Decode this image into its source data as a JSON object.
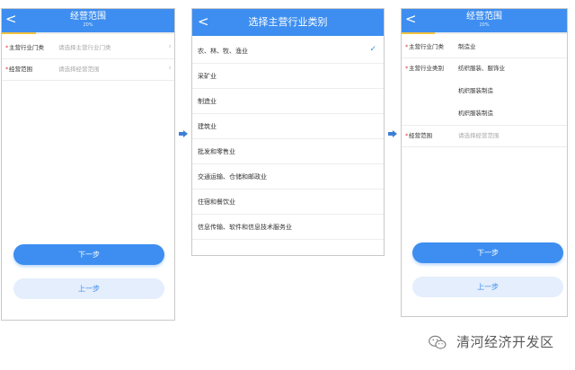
{
  "screen1": {
    "title": "经营范围",
    "progress_text": "20%",
    "progress_value": 0.2,
    "back_glyph": "<",
    "rows": [
      {
        "label": "主营行业门类",
        "placeholder": "请选择主营行业门类"
      },
      {
        "label": "经营范围",
        "placeholder": "请选择经营范围"
      }
    ],
    "next_label": "下一步",
    "prev_label": "上一步"
  },
  "screen2": {
    "title": "选择主营行业类别",
    "back_glyph": "<",
    "items": [
      {
        "label": "农、林、牧、渔业",
        "selected": true
      },
      {
        "label": "采矿业"
      },
      {
        "label": "制造业"
      },
      {
        "label": "建筑业"
      },
      {
        "label": "批发和零售业"
      },
      {
        "label": "交通运输、仓储和邮政业"
      },
      {
        "label": "住宿和餐饮业"
      },
      {
        "label": "信息传输、软件和信息技术服务业"
      }
    ]
  },
  "screen3": {
    "title": "经营范围",
    "progress_text": "20%",
    "progress_value": 0.2,
    "back_glyph": "<",
    "industry_label": "主营行业门类",
    "industry_value": "制造业",
    "category_label": "主营行业类别",
    "category_values": [
      "纺织服装、服饰业",
      "机织服装制造",
      "机织服装制造"
    ],
    "scope_label": "经营范围",
    "scope_placeholder": "请选择经营范围",
    "next_label": "下一步",
    "prev_label": "上一步"
  },
  "brand": {
    "name": "清河经济开发区",
    "icon": "wechat-icon"
  },
  "colors": {
    "primary": "#3d8ef0",
    "required": "#e53935",
    "progress": "#f3c23a",
    "arrow": "#3d7fd6"
  }
}
